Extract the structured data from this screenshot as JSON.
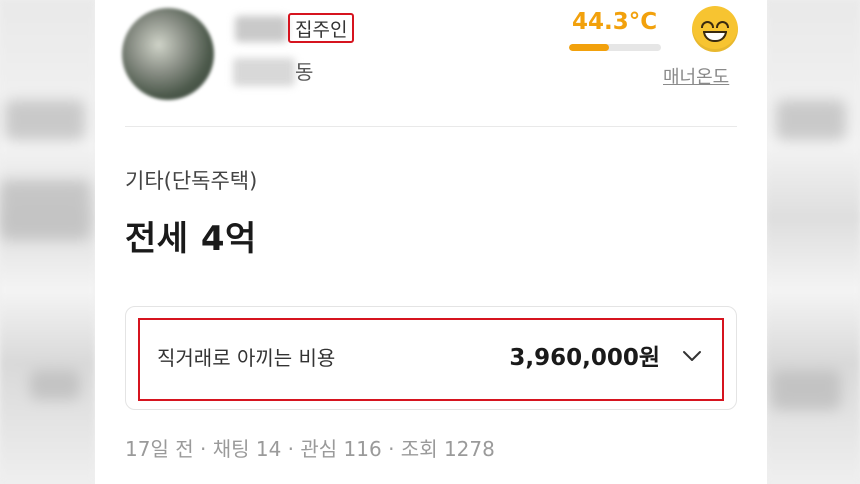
{
  "profile": {
    "role_badge": "집주인",
    "location_suffix": "동"
  },
  "manner": {
    "temperature": "44.3°C",
    "temperature_fill": 0.44,
    "link_label": "매너온도",
    "accent_color": "#f2a10c"
  },
  "listing": {
    "category": "기타(단독주택)",
    "price_title": "전세 4억"
  },
  "savings": {
    "label": "직거래로 아끼는 비용",
    "amount": "3,960,000원"
  },
  "meta": {
    "age": "17일 전",
    "chat": "채팅 14",
    "interest": "관심 116",
    "views": "조회 1278",
    "separator": " · "
  },
  "highlight_color": "#d6141f"
}
